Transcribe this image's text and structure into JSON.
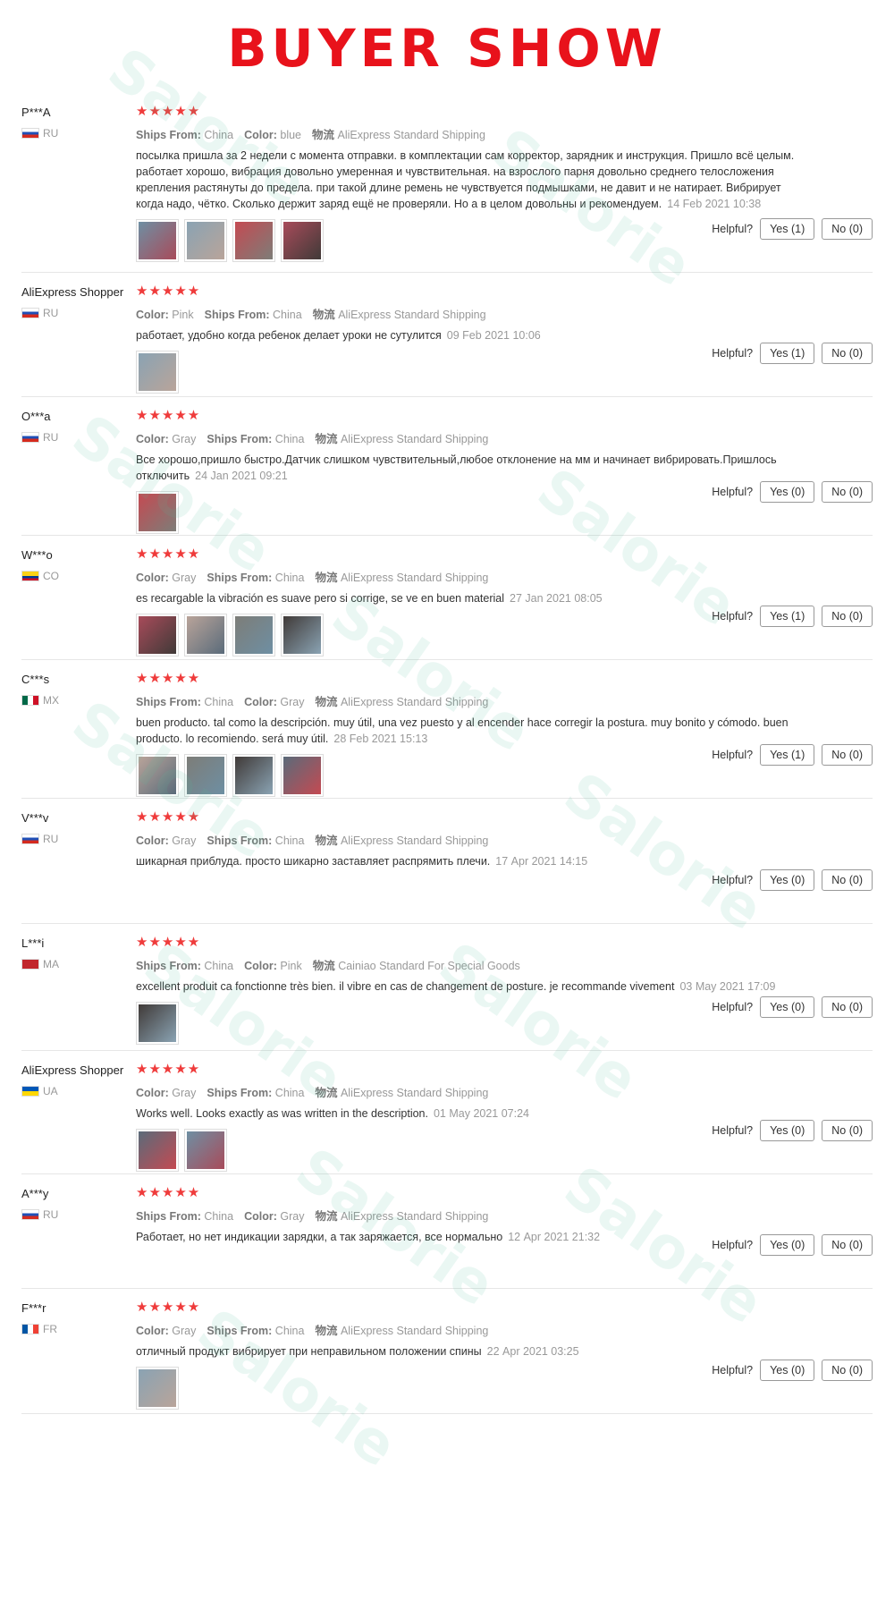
{
  "header": {
    "title": "BUYER SHOW"
  },
  "colors": {
    "accent": "#e8121b",
    "stars": "#ef3b3b"
  },
  "labels": {
    "ships_from": "Ships From:",
    "color": "Color:",
    "shipping": "物流",
    "helpful": "Helpful?"
  },
  "watermark": "Salorie",
  "reviews": [
    {
      "name": "P***A",
      "country": "RU",
      "stars": "★★★★★",
      "attrs": [
        [
          "Ships From:",
          "China"
        ],
        [
          "Color:",
          "blue"
        ],
        [
          "物流",
          "AliExpress Standard Shipping"
        ]
      ],
      "text": "посылка пришла за 2 недели с момента отправки. в комплектации сам корректор, зарядник и инструкция. Пришло всё целым. работает хорошо, вибрация довольно умеренная и чувствительная. на взрослого парня довольно среднего телосложения крепления растянуты до предела. при такой длине ремень не чувствуется подмышками, не давит и не натирает. Вибрирует когда надо, чётко. Сколько держит заряд ещё не проверяли. Но а в целом довольны и рекомендуем.",
      "date": "14 Feb 2021 10:38",
      "photos": 4,
      "yes": "Yes (1)",
      "no": "No (0)"
    },
    {
      "name": "AliExpress Shopper",
      "country": "RU",
      "stars": "★★★★★",
      "attrs": [
        [
          "Color:",
          "Pink"
        ],
        [
          "Ships From:",
          "China"
        ],
        [
          "物流",
          "AliExpress Standard Shipping"
        ]
      ],
      "text": "работает, удобно когда ребенок делает уроки не сутулится",
      "date": "09 Feb 2021 10:06",
      "photos": 1,
      "yes": "Yes (1)",
      "no": "No (0)"
    },
    {
      "name": "O***a",
      "country": "RU",
      "stars": "★★★★★",
      "attrs": [
        [
          "Color:",
          "Gray"
        ],
        [
          "Ships From:",
          "China"
        ],
        [
          "物流",
          "AliExpress Standard Shipping"
        ]
      ],
      "text": "Все хорошо,пришло быстро.Датчик слишком чувствительный,любое отклонение на мм и начинает вибрировать.Пришлось отключить",
      "date": "24 Jan 2021 09:21",
      "photos": 1,
      "yes": "Yes (0)",
      "no": "No (0)"
    },
    {
      "name": "W***o",
      "country": "CO",
      "stars": "★★★★★",
      "attrs": [
        [
          "Color:",
          "Gray"
        ],
        [
          "Ships From:",
          "China"
        ],
        [
          "物流",
          "AliExpress Standard Shipping"
        ]
      ],
      "text": "es recargable la vibración es suave pero si corrige, se ve en buen material",
      "date": "27 Jan 2021 08:05",
      "photos": 4,
      "yes": "Yes (1)",
      "no": "No (0)"
    },
    {
      "name": "C***s",
      "country": "MX",
      "stars": "★★★★★",
      "attrs": [
        [
          "Ships From:",
          "China"
        ],
        [
          "Color:",
          "Gray"
        ],
        [
          "物流",
          "AliExpress Standard Shipping"
        ]
      ],
      "text": "buen producto. tal como la descripción. muy útil, una vez puesto y al encender hace corregir la postura. muy bonito y cómodo. buen producto. lo recomiendo. será muy útil.",
      "date": "28 Feb 2021 15:13",
      "photos": 4,
      "yes": "Yes (1)",
      "no": "No (0)"
    },
    {
      "name": "V***v",
      "country": "RU",
      "stars": "★★★★★",
      "attrs": [
        [
          "Color:",
          "Gray"
        ],
        [
          "Ships From:",
          "China"
        ],
        [
          "物流",
          "AliExpress Standard Shipping"
        ]
      ],
      "text": "шикарная приблуда. просто шикарно заставляет распрямить плечи.",
      "date": "17 Apr 2021 14:15",
      "photos": 0,
      "yes": "Yes (0)",
      "no": "No (0)"
    },
    {
      "name": "L***i",
      "country": "MA",
      "stars": "★★★★★",
      "attrs": [
        [
          "Ships From:",
          "China"
        ],
        [
          "Color:",
          "Pink"
        ],
        [
          "物流",
          "Cainiao Standard For Special Goods"
        ]
      ],
      "text": "excellent produit ca fonctionne très bien. il vibre en cas de changement de posture. je recommande vivement",
      "date": "03 May 2021 17:09",
      "photos": 1,
      "yes": "Yes (0)",
      "no": "No (0)"
    },
    {
      "name": "AliExpress Shopper",
      "country": "UA",
      "stars": "★★★★★",
      "attrs": [
        [
          "Color:",
          "Gray"
        ],
        [
          "Ships From:",
          "China"
        ],
        [
          "物流",
          "AliExpress Standard Shipping"
        ]
      ],
      "text": "Works well. Looks exactly as was written in the description.",
      "date": "01 May 2021 07:24",
      "photos": 2,
      "yes": "Yes (0)",
      "no": "No (0)"
    },
    {
      "name": "A***y",
      "country": "RU",
      "stars": "★★★★★",
      "attrs": [
        [
          "Ships From:",
          "China"
        ],
        [
          "Color:",
          "Gray"
        ],
        [
          "物流",
          "AliExpress Standard Shipping"
        ]
      ],
      "text": "Работает, но нет индикации зарядки, а так заряжается, все нормально",
      "date": "12 Apr 2021 21:32",
      "photos": 0,
      "yes": "Yes (0)",
      "no": "No (0)"
    },
    {
      "name": "F***r",
      "country": "FR",
      "stars": "★★★★★",
      "attrs": [
        [
          "Color:",
          "Gray"
        ],
        [
          "Ships From:",
          "China"
        ],
        [
          "物流",
          "AliExpress Standard Shipping"
        ]
      ],
      "text": "отличный продукт вибрирует при неправильном положении спины",
      "date": "22 Apr 2021 03:25",
      "photos": 1,
      "yes": "Yes (0)",
      "no": "No (0)"
    }
  ]
}
